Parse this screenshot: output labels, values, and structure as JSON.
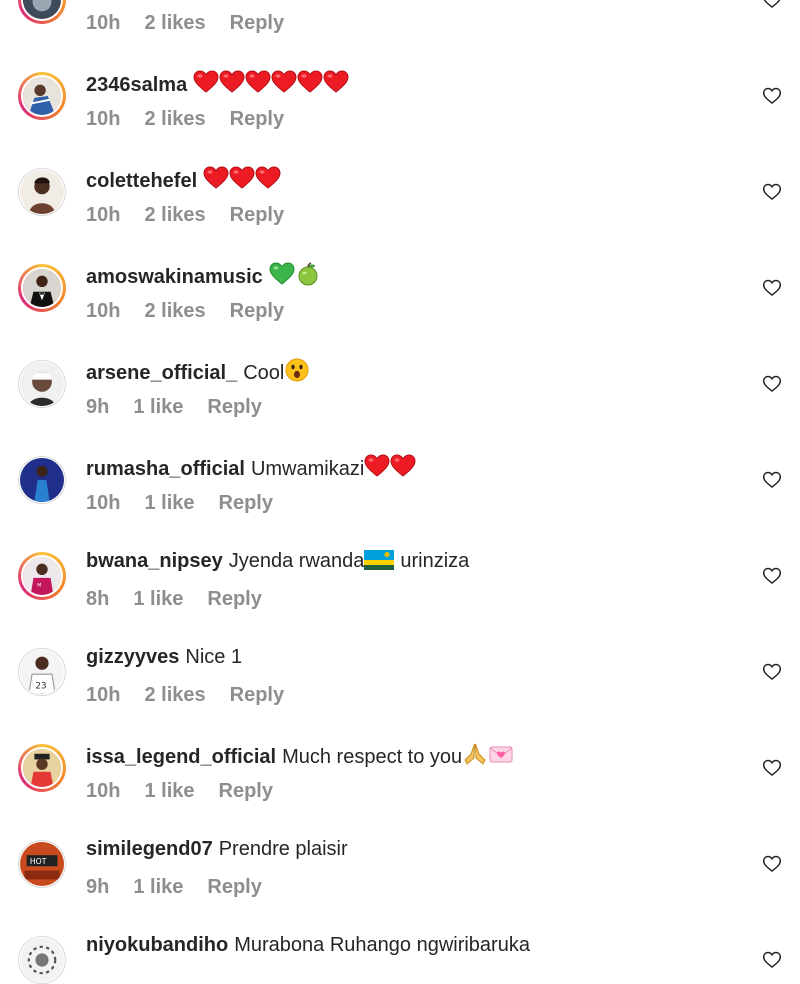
{
  "colors": {
    "text": "#262626",
    "meta": "#8e8e8e",
    "heart": "#ed1c24",
    "bg": "#ffffff"
  },
  "comments": [
    {
      "username": "",
      "text": "",
      "emojis": [],
      "time": "10h",
      "likes": "2 likes",
      "reply": "Reply",
      "avatar": "ring"
    },
    {
      "username": "2346salma",
      "text": "",
      "emojis": [
        "red-heart",
        "red-heart",
        "red-heart",
        "red-heart",
        "red-heart",
        "red-heart"
      ],
      "time": "10h",
      "likes": "2 likes",
      "reply": "Reply",
      "avatar": "ring"
    },
    {
      "username": "colettehefel",
      "text": "",
      "emojis": [
        "red-heart",
        "red-heart",
        "red-heart"
      ],
      "time": "10h",
      "likes": "2 likes",
      "reply": "Reply",
      "avatar": "plain"
    },
    {
      "username": "amoswakinamusic",
      "text": "",
      "emojis": [
        "green-heart",
        "green-apple"
      ],
      "time": "10h",
      "likes": "2 likes",
      "reply": "Reply",
      "avatar": "ring"
    },
    {
      "username": "arsene_official_",
      "text": "Cool",
      "emojis": [
        "astonished-face"
      ],
      "time": "9h",
      "likes": "1 like",
      "reply": "Reply",
      "avatar": "plain"
    },
    {
      "username": "rumasha_official",
      "text": "Umwamikazi",
      "emojis": [
        "red-heart",
        "red-heart"
      ],
      "time": "10h",
      "likes": "1 like",
      "reply": "Reply",
      "avatar": "plain"
    },
    {
      "username": "bwana_nipsey",
      "text": "Jyenda rwanda",
      "emojis": [
        "rwanda-flag"
      ],
      "text_after": "urinziza",
      "time": "8h",
      "likes": "1 like",
      "reply": "Reply",
      "avatar": "ring"
    },
    {
      "username": "gizzyyves",
      "text": "Nice 1",
      "emojis": [],
      "time": "10h",
      "likes": "2 likes",
      "reply": "Reply",
      "avatar": "plain"
    },
    {
      "username": "issa_legend_official",
      "text": "Much respect to you",
      "emojis": [
        "folded-hands",
        "love-letter"
      ],
      "time": "10h",
      "likes": "1 like",
      "reply": "Reply",
      "avatar": "ring"
    },
    {
      "username": "similegend07",
      "text": "Prendre plaisir",
      "emojis": [],
      "time": "9h",
      "likes": "1 like",
      "reply": "Reply",
      "avatar": "plain"
    },
    {
      "username": "niyokubandiho",
      "text": "Murabona Ruhango ngwiribaruka",
      "emojis": [],
      "time": "",
      "likes": "",
      "reply": "",
      "avatar": "plain"
    }
  ]
}
